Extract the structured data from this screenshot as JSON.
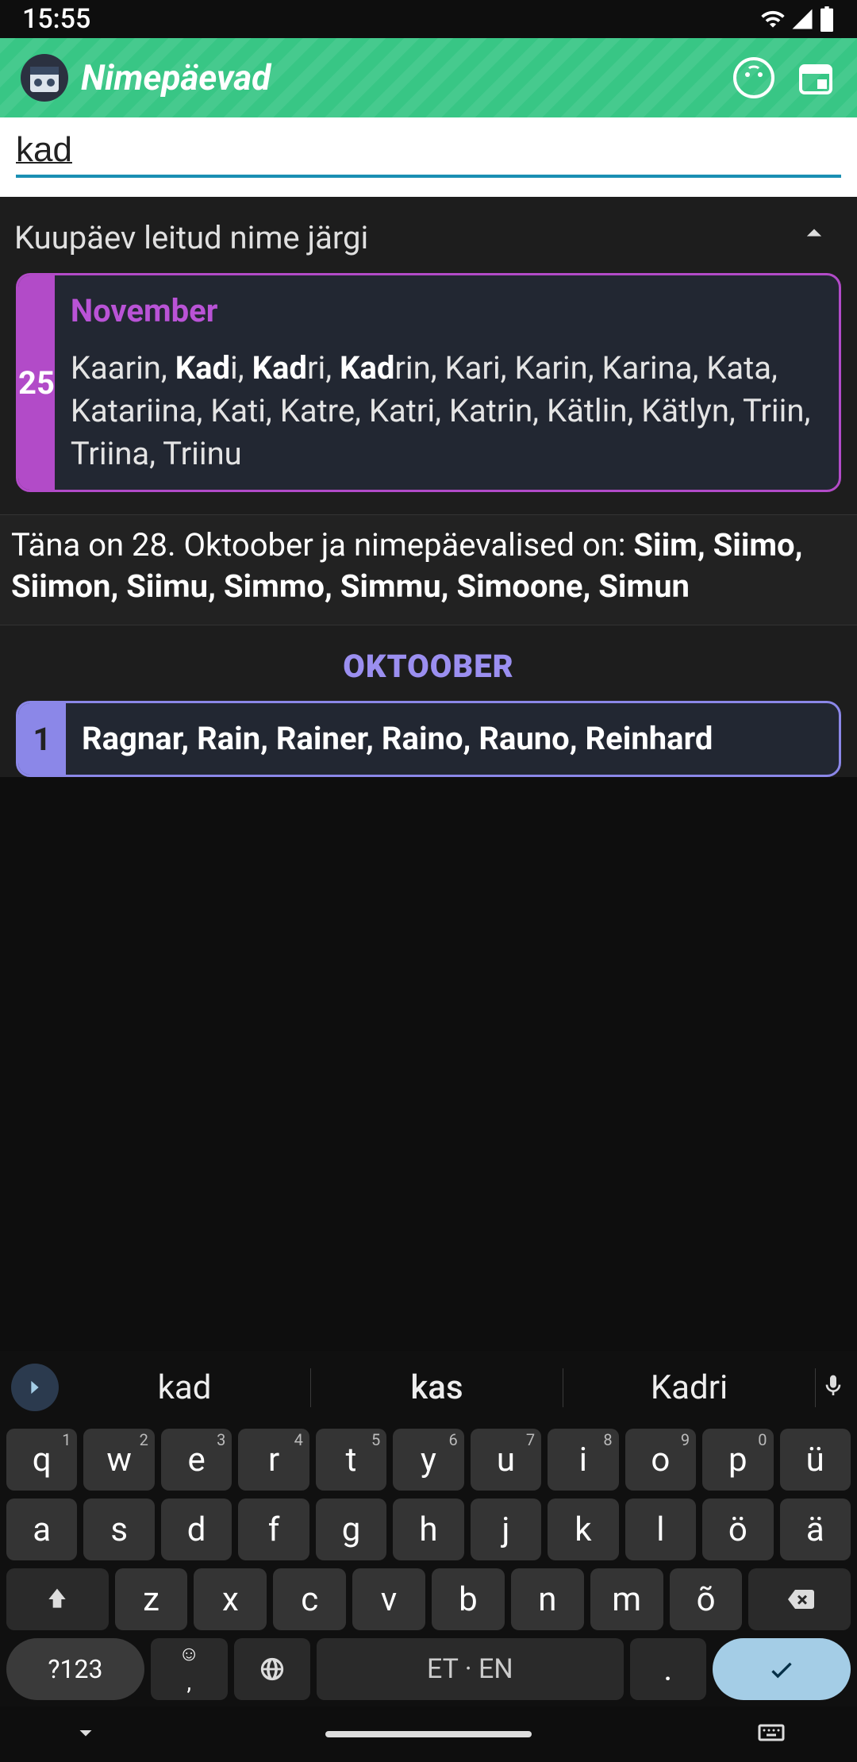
{
  "status": {
    "time": "15:55"
  },
  "header": {
    "title": "Nimepäevad"
  },
  "search": {
    "value": "kad"
  },
  "found": {
    "label": "Kuupäev leitud nime järgi",
    "card": {
      "day": "25",
      "month": "November",
      "pre1": "Kaarin, ",
      "b1": "Kad",
      "post1": "i, ",
      "b2": "Kad",
      "post2": "ri, ",
      "b3": "Kad",
      "post3": "rin, Kari, Karin, Karina, Kata, Katariina, Kati, Katre, Katri, Katrin, Kätlin, Kätlyn, Triin, Triina, Triinu"
    }
  },
  "today": {
    "text_pre": "Täna on 28. Oktoober ja nimepäevalised on: ",
    "names": "Siim, Siimo, Siimon, Siimu, Simmo, Simmu, Simoone, Simun"
  },
  "month_list": {
    "heading": "OKTOOBER",
    "row1": {
      "day": "1",
      "names": "Ragnar, Rain, Rainer, Raino, Rauno, Reinhard"
    }
  },
  "kb": {
    "suggest": [
      "kad",
      "kas",
      "Kadri"
    ],
    "r1": [
      {
        "k": "q",
        "s": "1"
      },
      {
        "k": "w",
        "s": "2"
      },
      {
        "k": "e",
        "s": "3"
      },
      {
        "k": "r",
        "s": "4"
      },
      {
        "k": "t",
        "s": "5"
      },
      {
        "k": "y",
        "s": "6"
      },
      {
        "k": "u",
        "s": "7"
      },
      {
        "k": "i",
        "s": "8"
      },
      {
        "k": "o",
        "s": "9"
      },
      {
        "k": "p",
        "s": "0"
      },
      {
        "k": "ü",
        "s": ""
      }
    ],
    "r2": [
      "a",
      "s",
      "d",
      "f",
      "g",
      "h",
      "j",
      "k",
      "l",
      "ö",
      "ä"
    ],
    "r3": [
      "z",
      "x",
      "c",
      "v",
      "b",
      "n",
      "m",
      "õ"
    ],
    "sym": "?123",
    "space": "ET · EN",
    "period": "."
  }
}
